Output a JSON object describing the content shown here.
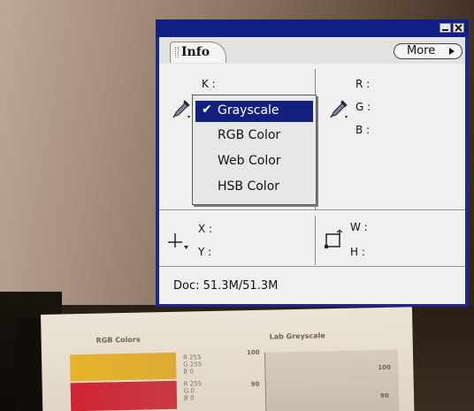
{
  "panel": {
    "tab_label": "Info",
    "more_button_label": "More",
    "doc_status": "Doc: 51.3M/51.3M"
  },
  "readouts": {
    "k": "K :",
    "r": "R :",
    "g": "G :",
    "b": "B :",
    "x": "X :",
    "y": "Y :",
    "w": "W :",
    "h": "H :"
  },
  "color_mode_menu": {
    "items": [
      {
        "label": "Grayscale",
        "selected": true
      },
      {
        "label": "RGB Color",
        "selected": false
      },
      {
        "label": "Web Color",
        "selected": false
      },
      {
        "label": "HSB Color",
        "selected": false
      }
    ],
    "check_glyph": "✔"
  },
  "background_card": {
    "left_caption": "RGB Colors",
    "right_caption": "Lab Greyscale",
    "labels_top": [
      "R 255",
      "G 255",
      "B 0"
    ],
    "labels_bottom": [
      "R 255",
      "G 0",
      "B 0"
    ],
    "ticks": [
      "100",
      "90",
      "100",
      "90"
    ]
  },
  "colors": {
    "title_bar": "#111e86",
    "menu_highlight": "#13207e",
    "panel_bg": "#f0f0f0"
  },
  "icons": [
    "eyedropper-icon",
    "crosshair-icon",
    "selection-size-icon",
    "close-icon",
    "minimize-icon",
    "more-arrow-icon"
  ]
}
